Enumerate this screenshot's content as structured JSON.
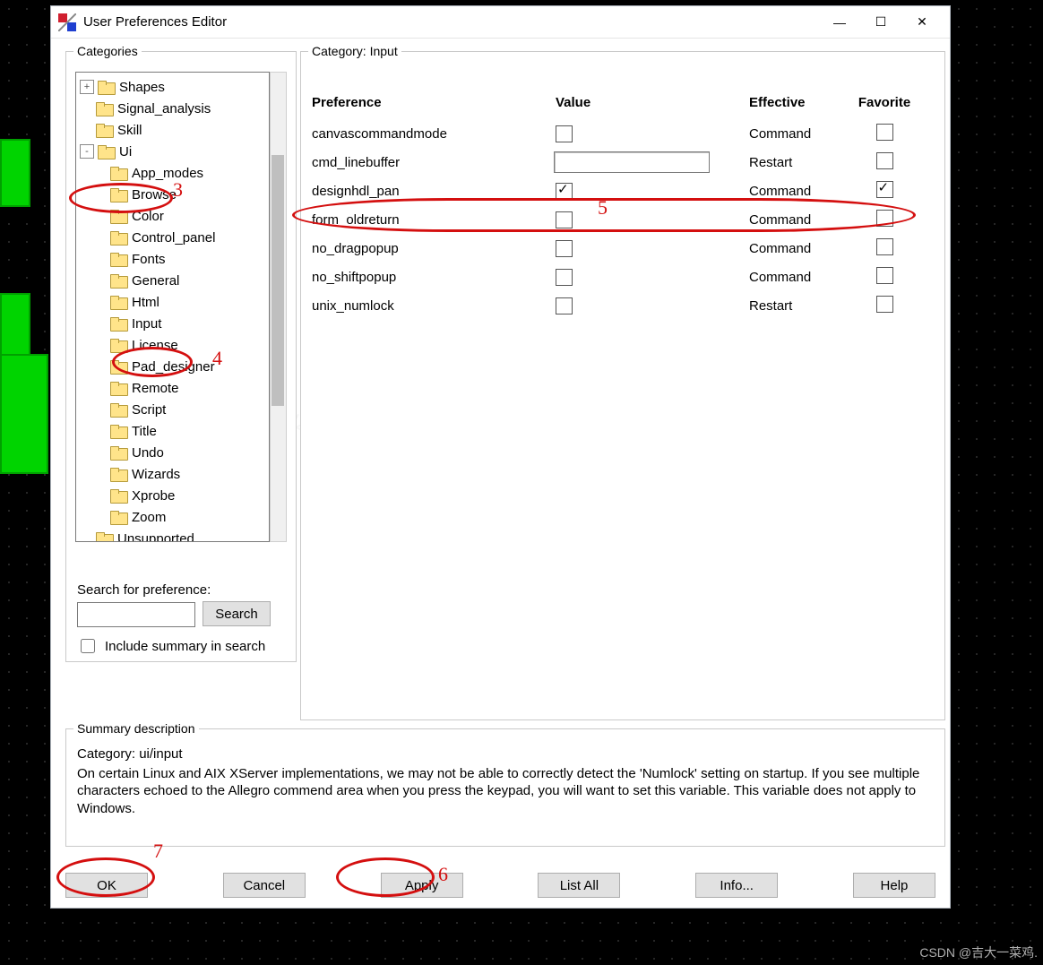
{
  "window": {
    "title": "User Preferences Editor",
    "min_label": "–",
    "max_label": "☐",
    "close_label": "✕"
  },
  "groupbox_labels": {
    "categories": "Categories",
    "category": "Category:   Input",
    "summary": "Summary description"
  },
  "tree": {
    "items": [
      {
        "label": "Shapes",
        "depth": 1,
        "exp": "+"
      },
      {
        "label": "Signal_analysis",
        "depth": 1,
        "exp": ""
      },
      {
        "label": "Skill",
        "depth": 1,
        "exp": ""
      },
      {
        "label": "Ui",
        "depth": 1,
        "exp": "-"
      },
      {
        "label": "App_modes",
        "depth": 2,
        "exp": ""
      },
      {
        "label": "Browse",
        "depth": 2,
        "exp": ""
      },
      {
        "label": "Color",
        "depth": 2,
        "exp": ""
      },
      {
        "label": "Control_panel",
        "depth": 2,
        "exp": ""
      },
      {
        "label": "Fonts",
        "depth": 2,
        "exp": ""
      },
      {
        "label": "General",
        "depth": 2,
        "exp": ""
      },
      {
        "label": "Html",
        "depth": 2,
        "exp": ""
      },
      {
        "label": "Input",
        "depth": 2,
        "exp": ""
      },
      {
        "label": "License",
        "depth": 2,
        "exp": ""
      },
      {
        "label": "Pad_designer",
        "depth": 2,
        "exp": ""
      },
      {
        "label": "Remote",
        "depth": 2,
        "exp": ""
      },
      {
        "label": "Script",
        "depth": 2,
        "exp": ""
      },
      {
        "label": "Title",
        "depth": 2,
        "exp": ""
      },
      {
        "label": "Undo",
        "depth": 2,
        "exp": ""
      },
      {
        "label": "Wizards",
        "depth": 2,
        "exp": ""
      },
      {
        "label": "Xprobe",
        "depth": 2,
        "exp": ""
      },
      {
        "label": "Zoom",
        "depth": 2,
        "exp": ""
      },
      {
        "label": "Unsupported",
        "depth": 1,
        "exp": ""
      }
    ]
  },
  "search": {
    "label": "Search for preference:",
    "button": "Search",
    "include_label": "Include summary in search"
  },
  "pref_table": {
    "headers": {
      "pref": "Preference",
      "val": "Value",
      "eff": "Effective",
      "fav": "Favorite"
    },
    "rows": [
      {
        "pref": "canvascommandmode",
        "val_type": "check",
        "val_checked": false,
        "eff": "Command",
        "fav": false
      },
      {
        "pref": "cmd_linebuffer",
        "val_type": "text",
        "val_text": "",
        "eff": "Restart",
        "fav": false
      },
      {
        "pref": "designhdl_pan",
        "val_type": "check",
        "val_checked": true,
        "eff": "Command",
        "fav": true
      },
      {
        "pref": "form_oldreturn",
        "val_type": "check",
        "val_checked": false,
        "eff": "Command",
        "fav": false
      },
      {
        "pref": "no_dragpopup",
        "val_type": "check",
        "val_checked": false,
        "eff": "Command",
        "fav": false
      },
      {
        "pref": "no_shiftpopup",
        "val_type": "check",
        "val_checked": false,
        "eff": "Command",
        "fav": false
      },
      {
        "pref": "unix_numlock",
        "val_type": "check",
        "val_checked": false,
        "eff": "Restart",
        "fav": false
      }
    ]
  },
  "summary": {
    "category_line": "Category: ui/input",
    "body": "On certain Linux and AIX XServer implementations, we may not be able to correctly detect the 'Numlock' setting on startup. If you see multiple characters echoed to the Allegro commend area when you press the keypad, you will want to set this variable. This variable does not apply to Windows."
  },
  "buttons": {
    "ok": "OK",
    "cancel": "Cancel",
    "apply": "Apply",
    "list_all": "List All",
    "info": "Info...",
    "help": "Help"
  },
  "annotations": {
    "a3": "3",
    "a4": "4",
    "a5": "5",
    "a6": "6",
    "a7": "7"
  },
  "watermark": "CSDN @吉大一菜鸡."
}
